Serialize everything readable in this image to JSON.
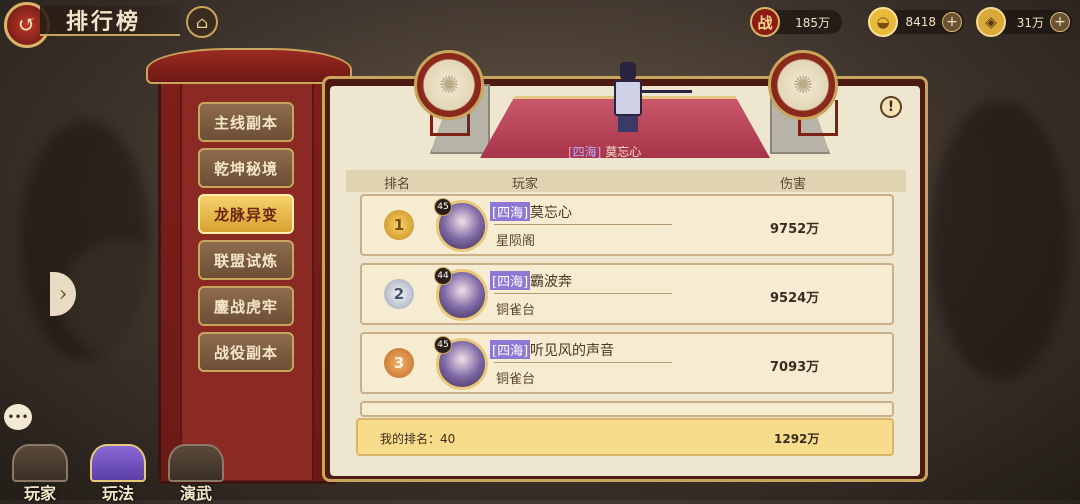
{
  "header": {
    "title": "排行榜",
    "back_icon": "back-icon",
    "home_icon": "home-icon"
  },
  "resources": {
    "power": {
      "icon_text": "战",
      "value": "185万"
    },
    "gold": {
      "icon": "gold-ingot-icon",
      "value": "8418"
    },
    "coin": {
      "icon": "copper-coin-icon",
      "value": "31万"
    }
  },
  "categories": [
    {
      "label": "主线副本",
      "active": false
    },
    {
      "label": "乾坤秘境",
      "active": false
    },
    {
      "label": "龙脉异变",
      "active": true
    },
    {
      "label": "联盟试炼",
      "active": false
    },
    {
      "label": "鏖战虎牢",
      "active": false
    },
    {
      "label": "战役副本",
      "active": false
    }
  ],
  "champion": {
    "server": "[四海]",
    "name": "莫忘心"
  },
  "table": {
    "headers": {
      "rank": "排名",
      "player": "玩家",
      "damage": "伤害"
    },
    "rows": [
      {
        "rank": "1",
        "level": "45",
        "server": "[四海]",
        "name": "莫忘心",
        "guild": "星陨阁",
        "damage": "9752万"
      },
      {
        "rank": "2",
        "level": "44",
        "server": "[四海]",
        "name": "霸波奔",
        "guild": "铜雀台",
        "damage": "9524万"
      },
      {
        "rank": "3",
        "level": "45",
        "server": "[四海]",
        "name": "听见风的声音",
        "guild": "铜雀台",
        "damage": "7093万"
      }
    ]
  },
  "my_rank": {
    "label": "我的排名：40",
    "damage": "1292万"
  },
  "bottom_nav": [
    {
      "label": "玩家",
      "active": false
    },
    {
      "label": "玩法",
      "active": true
    },
    {
      "label": "演武",
      "active": false
    }
  ],
  "colors": {
    "accent_gold": "#c9a45c",
    "active_tab": "#f6d26b",
    "server_tag": "#8e78d6",
    "board_bg": "#efe6cf"
  }
}
